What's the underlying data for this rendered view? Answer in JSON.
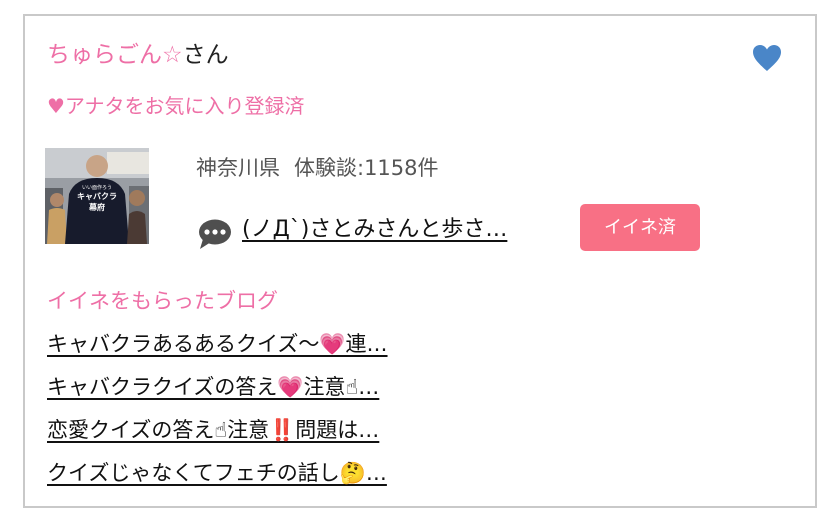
{
  "profile": {
    "name": "ちゅらごん☆",
    "name_suffix": "さん",
    "favorite_status": "♥アナタをお気に入り登録済",
    "favorite_icon": "heart-icon",
    "favorite_icon_color": "#4a86c8"
  },
  "review": {
    "thumbnail_caption": [
      "いい面作ろう",
      "キャバクラ",
      "幕府"
    ],
    "prefecture": "神奈川県",
    "count_text": "体験談:1158件",
    "latest_post": "(ノД`)さとみさんと歩さ…",
    "like_button": "イイネ済",
    "like_button_color": "#f87085"
  },
  "blogs": {
    "heading": "イイネをもらったブログ",
    "items": [
      {
        "title": "キャバクラあるあるクイズ〜💗連…"
      },
      {
        "title": "キャバクラクイズの答え💗注意☝…"
      },
      {
        "title": "恋愛クイズの答え☝注意‼️問題は…"
      },
      {
        "title": "クイズじゃなくてフェチの話し🤔…"
      }
    ]
  },
  "colors": {
    "accent_pink": "#ee6fa6",
    "border": "#c9c9c9"
  }
}
